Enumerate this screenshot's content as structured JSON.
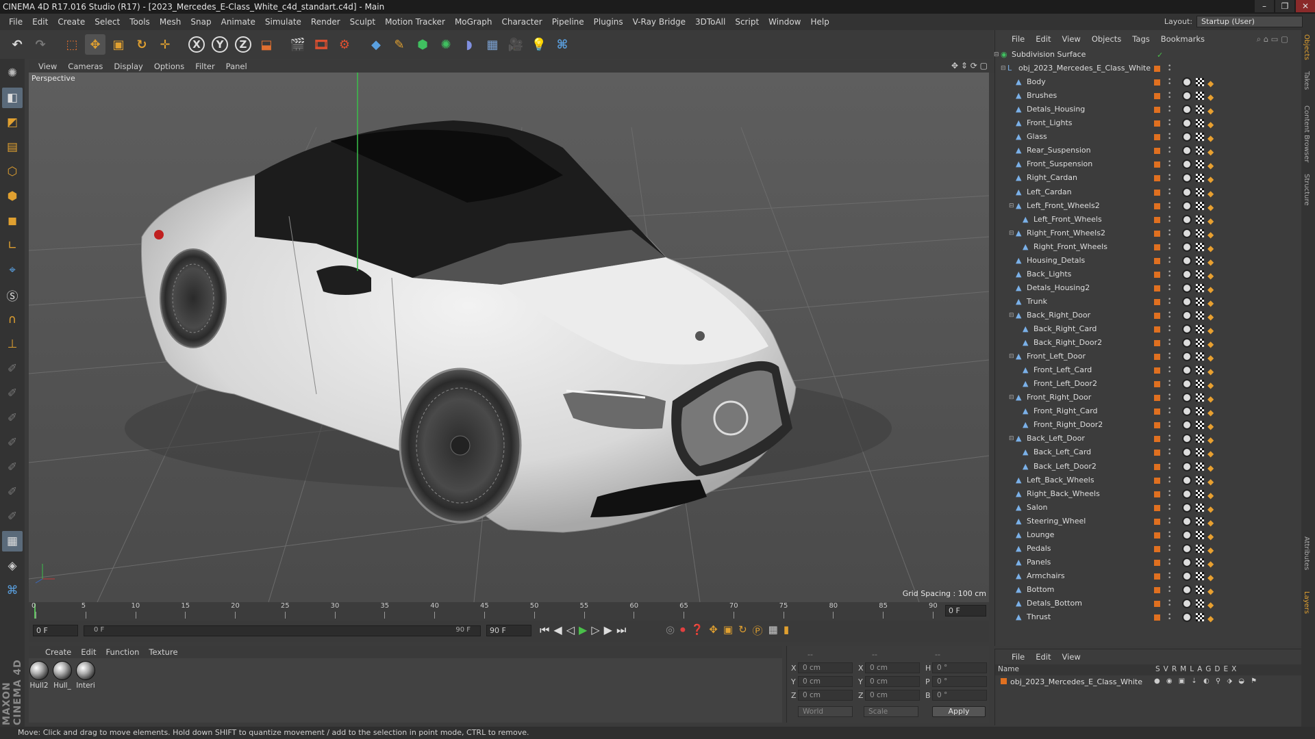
{
  "window": {
    "title": "CINEMA 4D R17.016 Studio (R17) - [2023_Mercedes_E-Class_White_c4d_standart.c4d] - Main",
    "controls": [
      "–",
      "❐",
      "✕"
    ]
  },
  "menubar": {
    "items": [
      "File",
      "Edit",
      "Create",
      "Select",
      "Tools",
      "Mesh",
      "Snap",
      "Animate",
      "Simulate",
      "Render",
      "Sculpt",
      "Motion Tracker",
      "MoGraph",
      "Character",
      "Pipeline",
      "Plugins",
      "V-Ray Bridge",
      "3DToAll",
      "Script",
      "Window",
      "Help"
    ],
    "layout_label": "Layout:",
    "layout_value": "Startup (User)"
  },
  "toolbar": {
    "axis_x": "X",
    "axis_y": "Y",
    "axis_z": "Z"
  },
  "viewport": {
    "menu": [
      "View",
      "Cameras",
      "Display",
      "Options",
      "Filter",
      "Panel"
    ],
    "label": "Perspective",
    "grid_spacing": "Grid Spacing : 100 cm"
  },
  "timeline": {
    "ticks": [
      "0",
      "5",
      "10",
      "15",
      "20",
      "25",
      "30",
      "35",
      "40",
      "45",
      "50",
      "55",
      "60",
      "65",
      "70",
      "75",
      "80",
      "85",
      "90"
    ],
    "current_frame_right": "0 F",
    "start_field": "0 F",
    "range_start": "0 F",
    "range_end": "90 F",
    "end_field": "90 F"
  },
  "material_manager": {
    "menu": [
      "Create",
      "Edit",
      "Function",
      "Texture"
    ],
    "materials": [
      "Hull2",
      "Hull_",
      "Interi"
    ]
  },
  "coordinates": {
    "header": [
      "--",
      "--",
      "--"
    ],
    "rows": [
      {
        "a": "X",
        "av": "0 cm",
        "b": "X",
        "bv": "0 cm",
        "c": "H",
        "cv": "0 °"
      },
      {
        "a": "Y",
        "av": "0 cm",
        "b": "Y",
        "bv": "0 cm",
        "c": "P",
        "cv": "0 °"
      },
      {
        "a": "Z",
        "av": "0 cm",
        "b": "Z",
        "bv": "0 cm",
        "c": "B",
        "cv": "0 °"
      }
    ],
    "world": "World",
    "scale": "Scale",
    "apply": "Apply"
  },
  "status": "Move: Click and drag to move elements. Hold down SHIFT to quantize movement / add to the selection in point mode, CTRL to remove.",
  "object_manager": {
    "menu": [
      "File",
      "Edit",
      "View",
      "Objects",
      "Tags",
      "Bookmarks"
    ],
    "objects": [
      {
        "name": "Subdivision Surface",
        "level": 0
      },
      {
        "name": "obj_2023_Mercedes_E_Class_White",
        "level": 1
      },
      {
        "name": "Body",
        "level": 2
      },
      {
        "name": "Brushes",
        "level": 2
      },
      {
        "name": "Detals_Housing",
        "level": 2
      },
      {
        "name": "Front_Lights",
        "level": 2
      },
      {
        "name": "Glass",
        "level": 2
      },
      {
        "name": "Rear_Suspension",
        "level": 2
      },
      {
        "name": "Front_Suspension",
        "level": 2
      },
      {
        "name": "Right_Cardan",
        "level": 2
      },
      {
        "name": "Left_Cardan",
        "level": 2
      },
      {
        "name": "Left_Front_Wheels2",
        "level": 2
      },
      {
        "name": "Left_Front_Wheels",
        "level": 3
      },
      {
        "name": "Right_Front_Wheels2",
        "level": 2
      },
      {
        "name": "Right_Front_Wheels",
        "level": 3
      },
      {
        "name": "Housing_Detals",
        "level": 2
      },
      {
        "name": "Back_Lights",
        "level": 2
      },
      {
        "name": "Detals_Housing2",
        "level": 2
      },
      {
        "name": "Trunk",
        "level": 2
      },
      {
        "name": "Back_Right_Door",
        "level": 2
      },
      {
        "name": "Back_Right_Card",
        "level": 3
      },
      {
        "name": "Back_Right_Door2",
        "level": 3
      },
      {
        "name": "Front_Left_Door",
        "level": 2
      },
      {
        "name": "Front_Left_Card",
        "level": 3
      },
      {
        "name": "Front_Left_Door2",
        "level": 3
      },
      {
        "name": "Front_Right_Door",
        "level": 2
      },
      {
        "name": "Front_Right_Card",
        "level": 3
      },
      {
        "name": "Front_Right_Door2",
        "level": 3
      },
      {
        "name": "Back_Left_Door",
        "level": 2
      },
      {
        "name": "Back_Left_Card",
        "level": 3
      },
      {
        "name": "Back_Left_Door2",
        "level": 3
      },
      {
        "name": "Left_Back_Wheels",
        "level": 2
      },
      {
        "name": "Right_Back_Wheels",
        "level": 2
      },
      {
        "name": "Salon",
        "level": 2
      },
      {
        "name": "Steering_Wheel",
        "level": 2
      },
      {
        "name": "Lounge",
        "level": 2
      },
      {
        "name": "Pedals",
        "level": 2
      },
      {
        "name": "Panels",
        "level": 2
      },
      {
        "name": "Armchairs",
        "level": 2
      },
      {
        "name": "Bottom",
        "level": 2
      },
      {
        "name": "Detals_Bottom",
        "level": 2
      },
      {
        "name": "Thrust",
        "level": 2
      }
    ]
  },
  "right_strip_tabs": [
    "Objects",
    "Takes",
    "Content Browser",
    "Structure",
    "Attributes",
    "Layers"
  ],
  "layer_manager": {
    "menu": [
      "File",
      "Edit",
      "View"
    ],
    "name_header": "Name",
    "columns": [
      "S",
      "V",
      "R",
      "M",
      "L",
      "A",
      "G",
      "D",
      "E",
      "X"
    ],
    "layer_name": "obj_2023_Mercedes_E_Class_White"
  },
  "maxon_logo": "MAXON CINEMA 4D"
}
